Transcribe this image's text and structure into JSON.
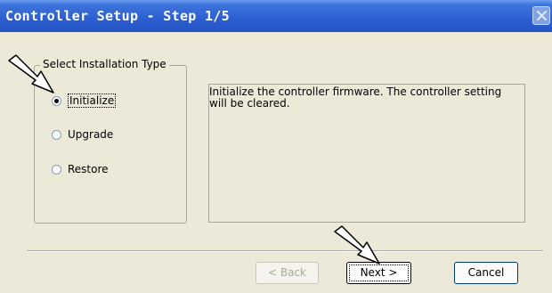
{
  "window": {
    "title": "Controller Setup - Step 1/5"
  },
  "install_group": {
    "legend": "Select Installation Type",
    "options": [
      {
        "label": "Initialize",
        "selected": true
      },
      {
        "label": "Upgrade",
        "selected": false
      },
      {
        "label": "Restore",
        "selected": false
      }
    ]
  },
  "description": {
    "text": "Initialize the controller firmware. The controller setting will be cleared."
  },
  "buttons": {
    "back": "< Back",
    "next": "Next >",
    "cancel": "Cancel"
  },
  "icons": [
    "close-icon",
    "pointer-arrow-icon"
  ],
  "colors": {
    "titlebar": "#2C5ED0",
    "dialog_bg": "#ECE9D8",
    "disabled_text": "#ACA899"
  }
}
